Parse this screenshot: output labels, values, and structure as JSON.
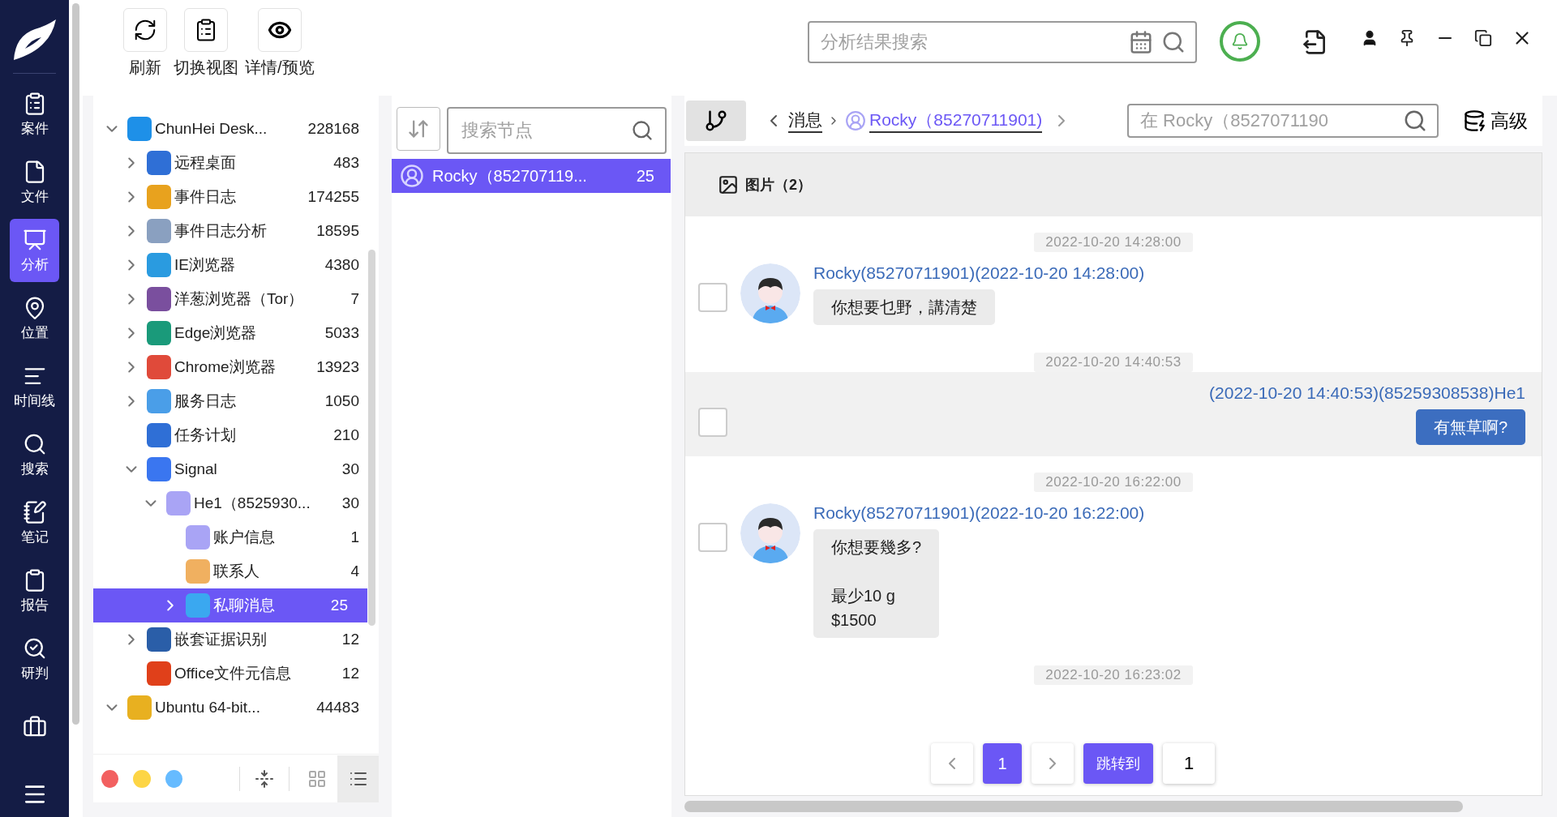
{
  "nav": {
    "items": [
      {
        "label": "案件",
        "selected": false
      },
      {
        "label": "文件",
        "selected": false
      },
      {
        "label": "分析",
        "selected": true
      },
      {
        "label": "位置",
        "selected": false
      },
      {
        "label": "时间线",
        "selected": false
      },
      {
        "label": "搜索",
        "selected": false
      },
      {
        "label": "笔记",
        "selected": false
      },
      {
        "label": "报告",
        "selected": false
      },
      {
        "label": "研判",
        "selected": false
      },
      {
        "selected": false
      }
    ]
  },
  "toolbar": {
    "buttons": [
      {
        "label": "刷新"
      },
      {
        "label": "切换视图"
      },
      {
        "label": "详情/预览"
      }
    ],
    "search": {
      "placeholder": "分析结果搜索"
    }
  },
  "tree": {
    "items": [
      {
        "label": "ChunHei  Desk...",
        "count": "228168",
        "expanded": true,
        "color": "#1e90e8",
        "selected": false,
        "children": [
          {
            "label": "远程桌面",
            "count": "483",
            "expanded": false,
            "color": "#2f6fd6",
            "selected": false
          },
          {
            "label": "事件日志",
            "count": "174255",
            "expanded": false,
            "color": "#e8a21e",
            "selected": false
          },
          {
            "label": "事件日志分析",
            "count": "18595",
            "expanded": false,
            "color": "#8aa0c0",
            "selected": false
          },
          {
            "label": "IE浏览器",
            "count": "4380",
            "expanded": false,
            "color": "#2a9be0",
            "selected": false
          },
          {
            "label": "洋葱浏览器（Tor）",
            "count": "7",
            "expanded": false,
            "color": "#7a4f9e",
            "selected": false
          },
          {
            "label": "Edge浏览器",
            "count": "5033",
            "expanded": false,
            "color": "#1a9a7a",
            "selected": false
          },
          {
            "label": "Chrome浏览器",
            "count": "13923",
            "expanded": false,
            "color": "#e04a3a",
            "selected": false
          },
          {
            "label": "服务日志",
            "count": "1050",
            "expanded": false,
            "color": "#4a9ee8",
            "selected": false
          },
          {
            "label": "任务计划",
            "count": "210",
            "color": "#2f6fd6",
            "selected": false
          },
          {
            "label": "Signal",
            "count": "30",
            "expanded": true,
            "color": "#3a76f0",
            "selected": false,
            "children": [
              {
                "label": "He1（8525930...",
                "count": "30",
                "expanded": true,
                "color": "#a9a4f5",
                "selected": false,
                "children": [
                  {
                    "label": "账户信息",
                    "count": "1",
                    "color": "#a9a4f5",
                    "selected": false
                  },
                  {
                    "label": "联系人",
                    "count": "4",
                    "color": "#f0b060",
                    "selected": false
                  },
                  {
                    "label": "私聊消息",
                    "count": "25",
                    "expanded": false,
                    "color": "#3aa8f0",
                    "selected": true
                  }
                ]
              }
            ]
          },
          {
            "label": "嵌套证据识别",
            "count": "12",
            "expanded": false,
            "color": "#2a5ea8",
            "selected": false
          },
          {
            "label": "Office文件元信息",
            "count": "12",
            "color": "#e0401a",
            "selected": false
          }
        ]
      },
      {
        "label": "Ubuntu 64-bit...",
        "count": "44483",
        "expanded": true,
        "color": "#e8b020",
        "selected": false
      }
    ]
  },
  "tree_footer": {
    "dots": [
      {
        "color": "#f26060"
      },
      {
        "color": "#fdd545"
      },
      {
        "color": "#66bbff"
      }
    ],
    "views": [
      {
        "selected": false
      },
      {
        "selected": true
      }
    ]
  },
  "node_list": {
    "search": {
      "placeholder": "搜索节点"
    },
    "items": [
      {
        "label": "Rocky（852707119...",
        "count": "25",
        "selected": true
      }
    ]
  },
  "breadcrumb": {
    "items": [
      "消息",
      "Rocky（85270711901)"
    ],
    "search": {
      "placeholder": "在 Rocky（8527071190"
    },
    "advanced": "高级"
  },
  "section": {
    "title": "图片（2）"
  },
  "messages": [
    {
      "kind": "incoming",
      "time": "2022-10-20 14:28:00",
      "sender": "Rocky(85270711901)(2022-10-20 14:28:00)",
      "text": "你想要乜野，講清楚",
      "checked": false,
      "highlighted": false
    },
    {
      "kind": "outgoing",
      "time": "2022-10-20 14:40:53",
      "sender": "(2022-10-20 14:40:53)(85259308538)He1",
      "text": "有無草啊?",
      "checked": false,
      "highlighted": true
    },
    {
      "kind": "incoming",
      "time": "2022-10-20 16:22:00",
      "sender": "Rocky(85270711901)(2022-10-20 16:22:00)",
      "text": "你想要幾多?\n\n最少10 g\n$1500",
      "checked": false,
      "highlighted": false
    },
    {
      "kind": "time_only",
      "time": "2022-10-20 16:23:02"
    }
  ],
  "pagination": {
    "pages": [
      {
        "label": "1",
        "selected": true
      }
    ],
    "jump": "跳转到",
    "value": "1"
  }
}
